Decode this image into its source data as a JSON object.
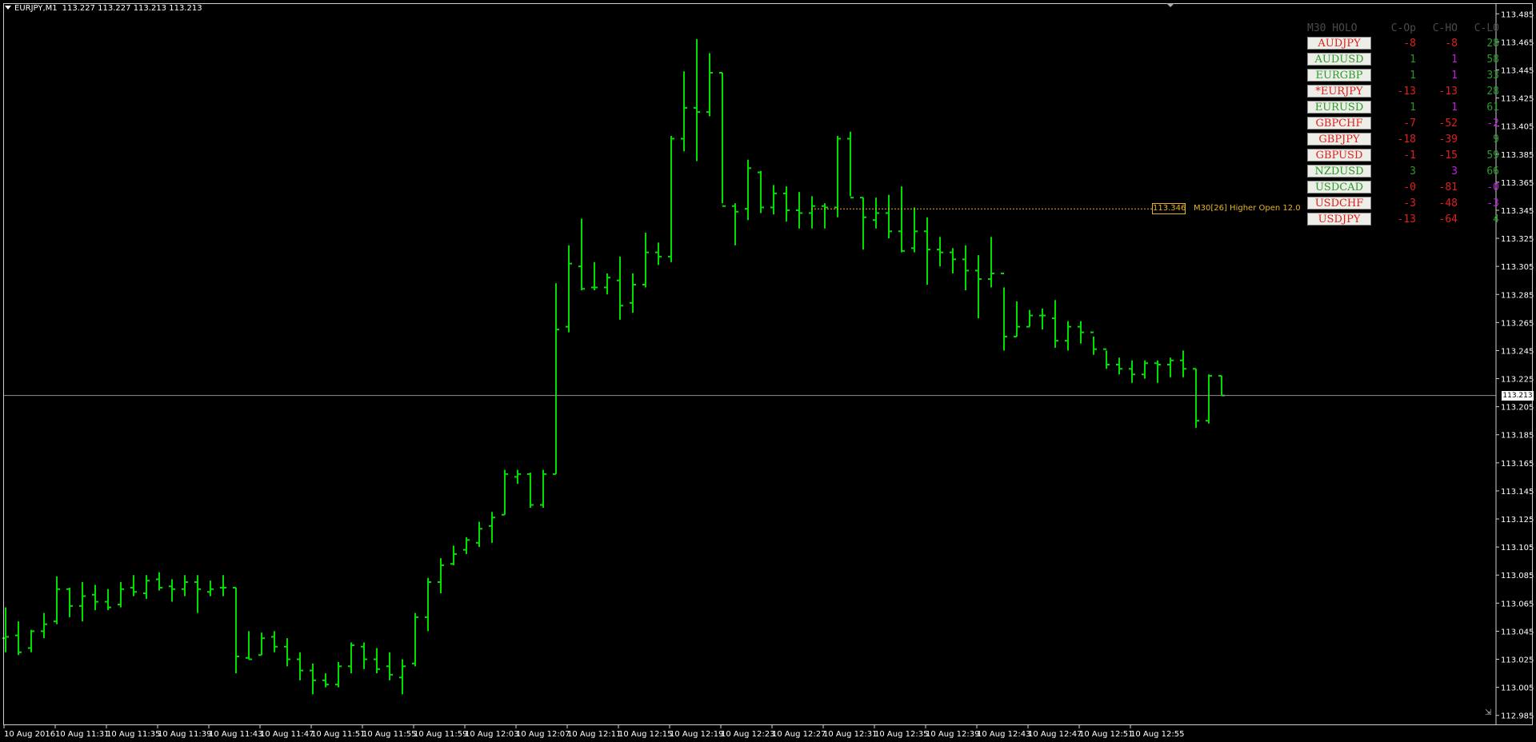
{
  "header": {
    "symbol": "EURJPY,M1",
    "ohlc": "113.227 113.227 113.213 113.213"
  },
  "colors": {
    "background": "#000000",
    "bars": "#00e000",
    "grid_text": "#ffffff",
    "annotation": "#e6b422",
    "red": "#e02020",
    "green": "#2a9a2a",
    "magenta": "#c020e0"
  },
  "annotation": {
    "price_box": "113.346",
    "label": "M30[26] Higher Open 12.0",
    "price": 113.346
  },
  "current_price": {
    "value": 113.213,
    "label": "113.213"
  },
  "panel": {
    "headers": [
      "M30 HOLO",
      "C-Op",
      "C-HO",
      "C-LO"
    ],
    "rows": [
      {
        "pair": "AUDJPY",
        "pair_color": "red",
        "c_op": "-8",
        "c_op_color": "red",
        "c_ho": "-8",
        "c_ho_color": "red",
        "c_lo": "28",
        "c_lo_color": "green"
      },
      {
        "pair": "AUDUSD",
        "pair_color": "green",
        "c_op": "1",
        "c_op_color": "green",
        "c_ho": "1",
        "c_ho_color": "magenta",
        "c_lo": "58",
        "c_lo_color": "green"
      },
      {
        "pair": "EURGBP",
        "pair_color": "green",
        "c_op": "1",
        "c_op_color": "green",
        "c_ho": "1",
        "c_ho_color": "magenta",
        "c_lo": "33",
        "c_lo_color": "green"
      },
      {
        "pair": "*EURJPY",
        "pair_color": "red",
        "c_op": "-13",
        "c_op_color": "red",
        "c_ho": "-13",
        "c_ho_color": "red",
        "c_lo": "28",
        "c_lo_color": "green"
      },
      {
        "pair": "EURUSD",
        "pair_color": "green",
        "c_op": "1",
        "c_op_color": "green",
        "c_ho": "1",
        "c_ho_color": "magenta",
        "c_lo": "61",
        "c_lo_color": "green"
      },
      {
        "pair": "GBPCHF",
        "pair_color": "red",
        "c_op": "-7",
        "c_op_color": "red",
        "c_ho": "-52",
        "c_ho_color": "red",
        "c_lo": "-2",
        "c_lo_color": "magenta"
      },
      {
        "pair": "GBPJPY",
        "pair_color": "red",
        "c_op": "-18",
        "c_op_color": "red",
        "c_ho": "-39",
        "c_ho_color": "red",
        "c_lo": "9",
        "c_lo_color": "green"
      },
      {
        "pair": "GBPUSD",
        "pair_color": "red",
        "c_op": "-1",
        "c_op_color": "red",
        "c_ho": "-15",
        "c_ho_color": "red",
        "c_lo": "59",
        "c_lo_color": "green"
      },
      {
        "pair": "NZDUSD",
        "pair_color": "green",
        "c_op": "3",
        "c_op_color": "green",
        "c_ho": "3",
        "c_ho_color": "magenta",
        "c_lo": "66",
        "c_lo_color": "green"
      },
      {
        "pair": "USDCAD",
        "pair_color": "green",
        "c_op": "-0",
        "c_op_color": "red",
        "c_ho": "-81",
        "c_ho_color": "red",
        "c_lo": "-0",
        "c_lo_color": "magenta"
      },
      {
        "pair": "USDCHF",
        "pair_color": "red",
        "c_op": "-3",
        "c_op_color": "red",
        "c_ho": "-48",
        "c_ho_color": "red",
        "c_lo": "-3",
        "c_lo_color": "magenta"
      },
      {
        "pair": "USDJPY",
        "pair_color": "red",
        "c_op": "-13",
        "c_op_color": "red",
        "c_ho": "-64",
        "c_ho_color": "red",
        "c_lo": "4",
        "c_lo_color": "green"
      }
    ]
  },
  "chart_data": {
    "type": "ohlc",
    "ylim": [
      112.978,
      113.492
    ],
    "y_ticks": [
      "113.485",
      "113.465",
      "113.445",
      "113.425",
      "113.405",
      "113.385",
      "113.365",
      "113.345",
      "113.325",
      "113.305",
      "113.285",
      "113.265",
      "113.245",
      "113.225",
      "113.205",
      "113.185",
      "113.165",
      "113.145",
      "113.125",
      "113.105",
      "113.085",
      "113.065",
      "113.045",
      "113.025",
      "113.005",
      "112.985"
    ],
    "x_ticks": [
      "10 Aug 2016",
      "10 Aug 11:31",
      "10 Aug 11:35",
      "10 Aug 11:39",
      "10 Aug 11:43",
      "10 Aug 11:47",
      "10 Aug 11:51",
      "10 Aug 11:55",
      "10 Aug 11:59",
      "10 Aug 12:03",
      "10 Aug 12:07",
      "10 Aug 12:11",
      "10 Aug 12:15",
      "10 Aug 12:19",
      "10 Aug 12:23",
      "10 Aug 12:27",
      "10 Aug 12:31",
      "10 Aug 12:35",
      "10 Aug 12:39",
      "10 Aug 12:43",
      "10 Aug 12:47",
      "10 Aug 12:51",
      "10 Aug 12:55"
    ],
    "bars": [
      [
        113.04,
        113.062,
        113.03,
        113.041
      ],
      [
        113.042,
        113.052,
        113.028,
        113.03
      ],
      [
        113.033,
        113.046,
        113.03,
        113.045
      ],
      [
        113.045,
        113.058,
        113.04,
        113.05
      ],
      [
        113.052,
        113.084,
        113.05,
        113.075
      ],
      [
        113.075,
        113.076,
        113.055,
        113.063
      ],
      [
        113.063,
        113.08,
        113.052,
        113.07
      ],
      [
        113.071,
        113.078,
        113.06,
        113.066
      ],
      [
        113.066,
        113.075,
        113.06,
        113.062
      ],
      [
        113.064,
        113.08,
        113.062,
        113.075
      ],
      [
        113.076,
        113.085,
        113.07,
        113.073
      ],
      [
        113.072,
        113.085,
        113.068,
        113.081
      ],
      [
        113.082,
        113.087,
        113.074,
        113.076
      ],
      [
        113.077,
        113.082,
        113.066,
        113.075
      ],
      [
        113.075,
        113.085,
        113.07,
        113.08
      ],
      [
        113.08,
        113.085,
        113.058,
        113.075
      ],
      [
        113.073,
        113.081,
        113.07,
        113.075
      ],
      [
        113.076,
        113.085,
        113.07,
        113.076
      ],
      [
        113.076,
        113.076,
        113.015,
        113.027
      ],
      [
        113.026,
        113.045,
        113.025,
        113.025
      ],
      [
        113.028,
        113.044,
        113.028,
        113.04
      ],
      [
        113.041,
        113.045,
        113.03,
        113.034
      ],
      [
        113.034,
        113.04,
        113.02,
        113.025
      ],
      [
        113.025,
        113.03,
        113.01,
        113.017
      ],
      [
        113.017,
        113.022,
        113.0,
        113.01
      ],
      [
        113.01,
        113.015,
        113.005,
        113.007
      ],
      [
        113.007,
        113.023,
        113.005,
        113.02
      ],
      [
        113.02,
        113.037,
        113.015,
        113.035
      ],
      [
        113.034,
        113.037,
        113.018,
        113.025
      ],
      [
        113.025,
        113.033,
        113.015,
        113.018
      ],
      [
        113.02,
        113.03,
        113.01,
        113.014
      ],
      [
        113.012,
        113.025,
        113.0,
        113.02
      ],
      [
        113.022,
        113.058,
        113.02,
        113.055
      ],
      [
        113.055,
        113.083,
        113.045,
        113.08
      ],
      [
        113.08,
        113.097,
        113.072,
        113.092
      ],
      [
        113.093,
        113.106,
        113.092,
        113.1
      ],
      [
        113.103,
        113.112,
        113.1,
        113.11
      ],
      [
        113.108,
        113.123,
        113.105,
        113.118
      ],
      [
        113.12,
        113.13,
        113.108,
        113.126
      ],
      [
        113.128,
        113.16,
        113.128,
        113.157
      ],
      [
        113.155,
        113.16,
        113.15,
        113.157
      ],
      [
        113.157,
        113.158,
        113.133,
        113.135
      ],
      [
        113.135,
        113.16,
        113.133,
        113.157
      ],
      [
        113.157,
        113.293,
        113.157,
        113.26
      ],
      [
        113.262,
        113.32,
        113.258,
        113.307
      ],
      [
        113.305,
        113.339,
        113.288,
        113.289
      ],
      [
        113.29,
        113.308,
        113.288,
        113.29
      ],
      [
        113.29,
        113.3,
        113.285,
        113.297
      ],
      [
        113.295,
        113.312,
        113.267,
        113.277
      ],
      [
        113.279,
        113.3,
        113.272,
        113.292
      ],
      [
        113.292,
        113.329,
        113.29,
        113.315
      ],
      [
        113.315,
        113.322,
        113.306,
        113.312
      ],
      [
        113.312,
        113.398,
        113.308,
        113.396
      ],
      [
        113.396,
        113.444,
        113.387,
        113.418
      ],
      [
        113.418,
        113.467,
        113.38,
        113.415
      ],
      [
        113.415,
        113.457,
        113.412,
        113.443
      ],
      [
        113.443,
        113.443,
        113.35,
        113.348
      ],
      [
        113.348,
        113.35,
        113.32,
        113.344
      ],
      [
        113.346,
        113.381,
        113.338,
        113.375
      ],
      [
        113.372,
        113.373,
        113.343,
        113.347
      ],
      [
        113.347,
        113.363,
        113.342,
        113.357
      ],
      [
        113.357,
        113.362,
        113.337,
        113.345
      ],
      [
        113.345,
        113.358,
        113.332,
        113.343
      ],
      [
        113.343,
        113.355,
        113.332,
        113.348
      ],
      [
        113.348,
        113.35,
        113.332,
        113.347
      ],
      [
        113.347,
        113.398,
        113.34,
        113.396
      ],
      [
        113.396,
        113.401,
        113.355,
        113.354
      ],
      [
        113.354,
        113.354,
        113.317,
        113.34
      ],
      [
        113.338,
        113.354,
        113.332,
        113.343
      ],
      [
        113.343,
        113.356,
        113.325,
        113.33
      ],
      [
        113.33,
        113.362,
        113.315,
        113.316
      ],
      [
        113.318,
        113.347,
        113.315,
        113.33
      ],
      [
        113.33,
        113.34,
        113.292,
        113.317
      ],
      [
        113.317,
        113.326,
        113.305,
        113.315
      ],
      [
        113.315,
        113.318,
        113.3,
        113.31
      ],
      [
        113.31,
        113.32,
        113.288,
        113.302
      ],
      [
        113.302,
        113.313,
        113.268,
        113.296
      ],
      [
        113.296,
        113.326,
        113.29,
        113.3
      ],
      [
        113.3,
        113.29,
        113.245,
        113.255
      ],
      [
        113.255,
        113.28,
        113.255,
        113.262
      ],
      [
        113.262,
        113.274,
        113.262,
        113.27
      ],
      [
        113.27,
        113.275,
        113.26,
        113.27
      ],
      [
        113.268,
        113.281,
        113.247,
        113.252
      ],
      [
        113.252,
        113.266,
        113.245,
        113.262
      ],
      [
        113.262,
        113.266,
        113.25,
        113.258
      ],
      [
        113.258,
        113.255,
        113.242,
        113.246
      ],
      [
        113.246,
        113.245,
        113.232,
        113.235
      ],
      [
        113.235,
        113.24,
        113.228,
        113.232
      ],
      [
        113.232,
        113.238,
        113.222,
        113.228
      ],
      [
        113.228,
        113.238,
        113.225,
        113.236
      ],
      [
        113.236,
        113.238,
        113.222,
        113.235
      ],
      [
        113.235,
        113.24,
        113.226,
        113.238
      ],
      [
        113.238,
        113.245,
        113.226,
        113.232
      ],
      [
        113.232,
        113.232,
        113.19,
        113.195
      ],
      [
        113.195,
        113.228,
        113.193,
        113.227
      ],
      [
        113.227,
        113.227,
        113.213,
        113.213
      ]
    ]
  }
}
